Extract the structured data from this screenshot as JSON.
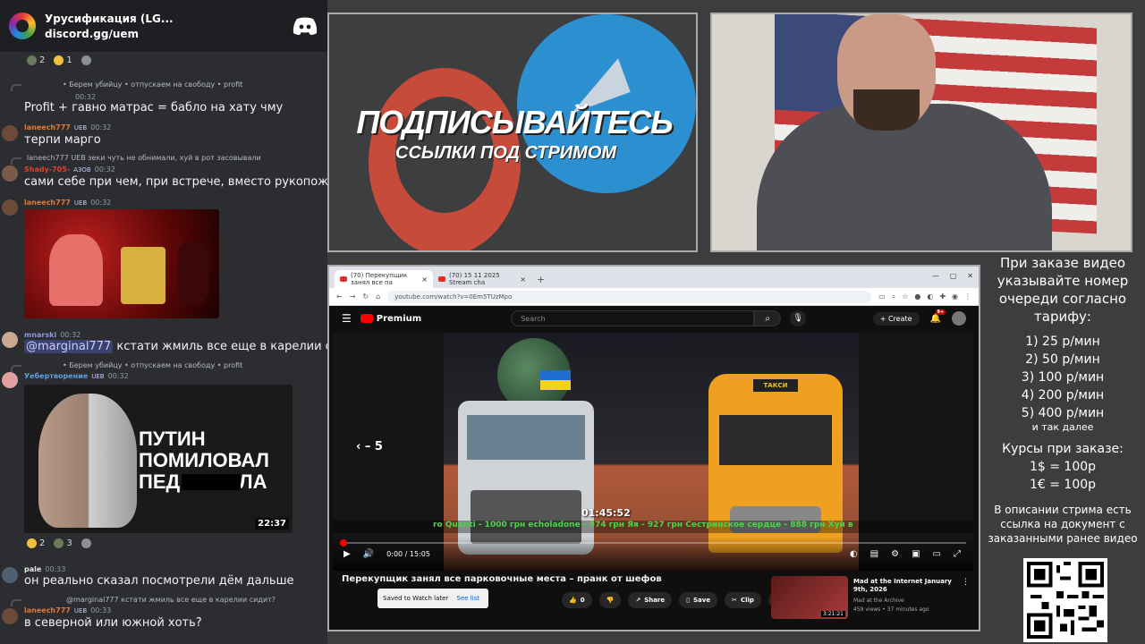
{
  "discord": {
    "server_name": "Урусификация (LG...",
    "invite": "discord.gg/uem",
    "reactions_top": [
      "2",
      "1"
    ],
    "reply1": "• Берем убийцу • отпускаем на свободу • profit",
    "time1": "00:32",
    "msg1": "Profit + гавно матрас = бабло на хату чму",
    "user2": "laneech777",
    "badge2": "UEB",
    "time2": "00:32",
    "msg2": "терпи марго",
    "reply3": "laneech777 UEB зеки чуть не обнимали, хуй в рот засовывали",
    "user3": "Shady-705-",
    "badge3": "АЗОВ",
    "time3": "00:32",
    "msg3": "сами себе при чем, при встрече, вместо рукопожатия",
    "user4": "laneech777",
    "badge4": "UEB",
    "time4": "00:32",
    "user5": "mnarski",
    "time5": "00:32",
    "mention5": "@marginal777",
    "msg5": "кстати жмиль все еще в карелии сидит?",
    "reply6": "• Берем убийцу • отпускаем на свободу • profit",
    "user6": "Уебертворение",
    "badge6": "UEB",
    "time6": "00:32",
    "video_line1": "ПУТИН",
    "video_line2": "ПОМИЛОВАЛ",
    "video_line3": "ПЕД",
    "video_line3_end": "ЛА",
    "video_duration": "22:37",
    "reactions_mid": [
      "2",
      "3"
    ],
    "user7": "pale",
    "time7": "00:33",
    "msg7": "он реально сказал посмотрели дём дальше",
    "reply8": "@marginal777 кстати жмиль все еще в карелии сидит?",
    "user8": "laneech777",
    "badge8": "UEB",
    "time8": "00:33",
    "msg8": "в северной или южной хоть?"
  },
  "promo": {
    "headline": "ПОДПИСЫВАЙТЕСЬ",
    "subline": "ССЫЛКИ ПОД СТРИМОМ"
  },
  "browser": {
    "tab1": "(70) Перекупщик занял все па",
    "tab2": "(70) 15 11 2025 Stream cha",
    "url": "youtube.com/watch?v=0Em5TUzMpo",
    "yt": {
      "logo": "Premium",
      "search_placeholder": "Search",
      "create": "Create",
      "notif_count": "9+",
      "rewind": "‹  – 5",
      "ticker": "ro Quanti - 1000 грн    echoladone - 974 грн    Яя - 927 грн    Сестринское сердце - 888 грн    Хуй в",
      "overlay_time": "01:45:52",
      "van_label": "ТАКСИ",
      "time_display": "0:00 / 15:05",
      "progress": 0.005,
      "video_title": "Перекупщик занял все парковочные места – пранк от шефов",
      "toast_text": "Saved to Watch later",
      "toast_action": "See list",
      "likes": "0",
      "share": "Share",
      "save": "Save",
      "clip": "Clip",
      "rec_title": "Mad at the Internet January 9th, 2026",
      "rec_channel": "Mad at the Archive",
      "rec_views": "459 views • 37 minutes ago",
      "rec_duration": "3:21:21"
    }
  },
  "info": {
    "order_text": "При заказе видео указывайте номер очереди согласно тарифу:",
    "tariffs": [
      "1) 25 р/мин",
      "2) 50 р/мин",
      "3) 100 р/мин",
      "4) 200 р/мин",
      "5) 400 р/мин"
    ],
    "etc": "и так далее",
    "rates_title": "Курсы при заказе:",
    "rate_usd": "1$ = 100р",
    "rate_eur": "1€ = 100р",
    "description": "В описании стрима есть ссылка на документ с заказанными ранее видео"
  }
}
